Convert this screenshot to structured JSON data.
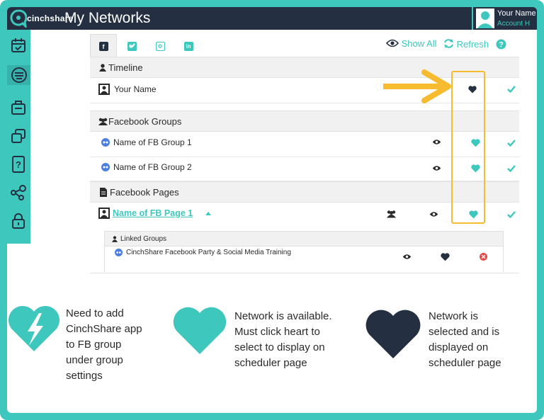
{
  "brand": {
    "logo_text": "cinchshare",
    "accent": "#3ec8bd",
    "dark": "#243042",
    "highlight": "#f6bb2e",
    "danger": "#e84a4a"
  },
  "header": {
    "title": "My Networks",
    "account_name": "Your Name",
    "account_sub": "Account  H"
  },
  "sidebar": {
    "items": [
      {
        "icon": "calendar-icon"
      },
      {
        "icon": "networks-icon"
      },
      {
        "icon": "briefcase-icon"
      },
      {
        "icon": "copy-icon"
      },
      {
        "icon": "help-card-icon"
      },
      {
        "icon": "share-nodes-icon"
      },
      {
        "icon": "lock-icon"
      }
    ]
  },
  "tabs": [
    {
      "name": "facebook",
      "icon": "facebook-icon",
      "active": true
    },
    {
      "name": "twitter",
      "icon": "twitter-icon",
      "active": false
    },
    {
      "name": "instagram",
      "icon": "instagram-icon",
      "active": false
    },
    {
      "name": "linkedin",
      "icon": "linkedin-icon",
      "active": false
    }
  ],
  "actions": {
    "show_all": "Show All",
    "refresh": "Refresh"
  },
  "sections": {
    "timeline": "Timeline",
    "groups": "Facebook Groups",
    "pages": "Facebook Pages"
  },
  "rows": {
    "profile": {
      "name": "Your Name",
      "heart": "selected"
    },
    "group1": {
      "name": "Name of FB Group 1",
      "heart": "available"
    },
    "group2": {
      "name": "Name of FB Group 2",
      "heart": "available"
    },
    "page1": {
      "name": "Name of FB Page 1",
      "heart": "available"
    }
  },
  "linked_groups": {
    "title": "Linked Groups",
    "items": [
      {
        "name": "CinchShare Facebook Party & Social Media Training",
        "heart": "selected"
      }
    ]
  },
  "legend": [
    {
      "icon": "broken-heart-icon",
      "text": [
        "Need to add",
        "CinchShare app",
        "to FB group",
        "under group",
        "settings"
      ]
    },
    {
      "icon": "heart-available-icon",
      "text": [
        "Network is available.",
        "Must click heart to",
        "select to display on",
        "scheduler page"
      ]
    },
    {
      "icon": "heart-selected-icon",
      "text": [
        "Network is",
        "selected and is",
        "displayed on",
        "scheduler page"
      ]
    }
  ]
}
